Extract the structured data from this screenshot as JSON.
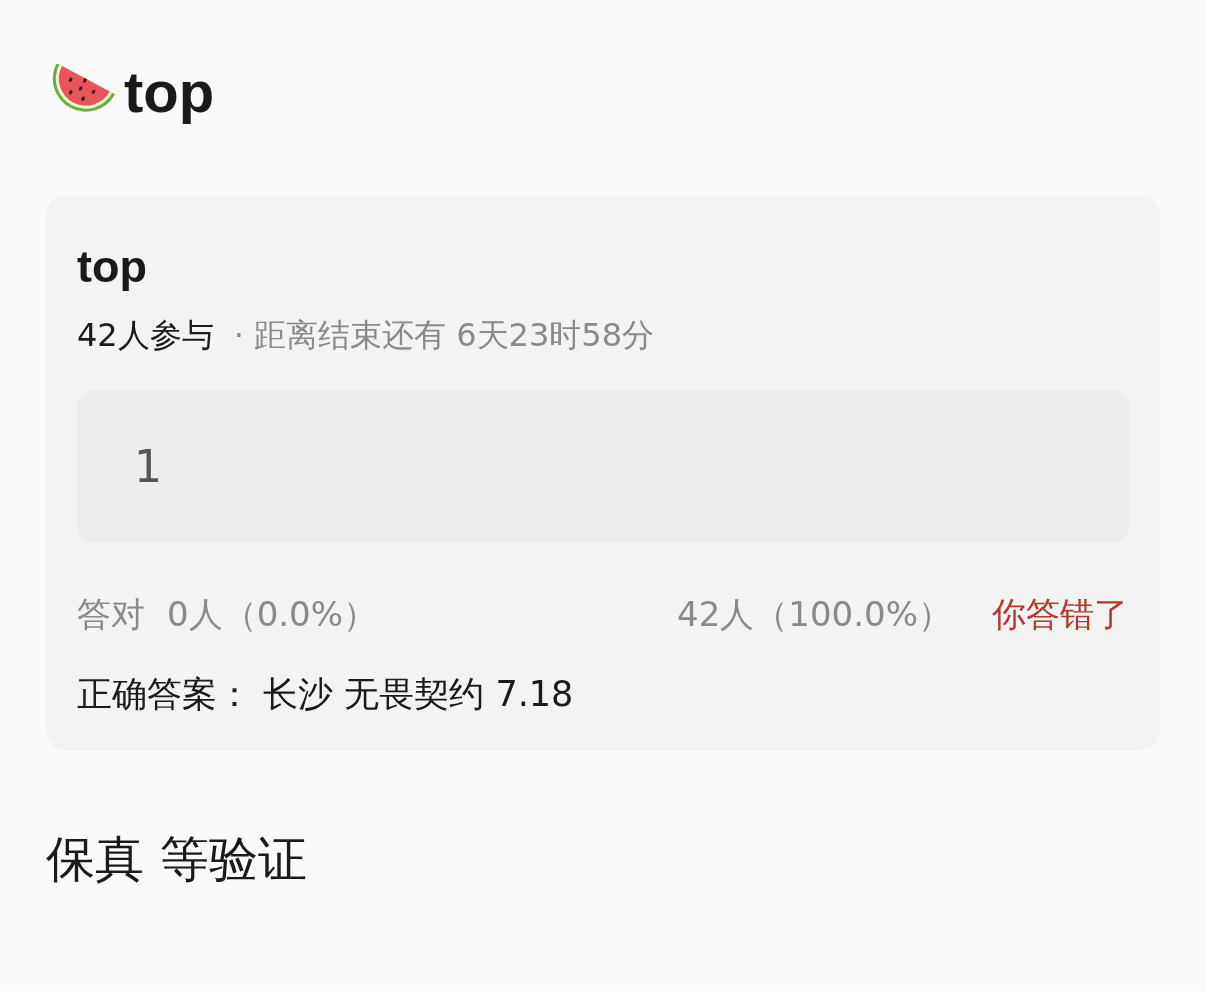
{
  "header": {
    "title": "top"
  },
  "poll": {
    "title": "top",
    "participants": "42人参与",
    "deadline": "· 距离结束还有 6天23时58分",
    "answer_box": {
      "value": "1"
    },
    "correct_stats": {
      "label": "答对",
      "value": "0人（0.0%）"
    },
    "wrong_stats": "42人（100.0%）",
    "result": {
      "text": "你答错了",
      "correct": false
    },
    "answer": "正确答案： 长沙 无畏契约 7.18"
  },
  "footer_note": "保真 等验证"
}
